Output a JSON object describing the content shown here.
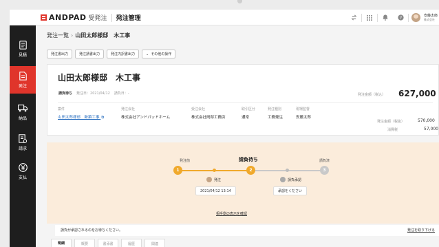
{
  "brand": {
    "logo": "ANDPAD",
    "product": "受発注",
    "app_title": "発注管理",
    "accent": "#e0352b"
  },
  "user": {
    "name": "安藤太郎",
    "company": "株式会社"
  },
  "sidebar": {
    "items": [
      {
        "label": "見積",
        "icon": "estimate-icon",
        "active": false
      },
      {
        "label": "発注",
        "icon": "order-icon",
        "active": true
      },
      {
        "label": "納品",
        "icon": "delivery-truck-icon",
        "active": false
      },
      {
        "label": "請求",
        "icon": "invoice-icon",
        "active": false
      },
      {
        "label": "支払",
        "icon": "yen-icon",
        "active": false
      }
    ]
  },
  "breadcrumb": {
    "parent": "発注一覧",
    "separator": "›",
    "current": "山田太郎様邸　木工事"
  },
  "actions": [
    {
      "label": "発注書出力"
    },
    {
      "label": "発注請書出力"
    },
    {
      "label": "発注内訳書出力"
    },
    {
      "label": "その他の操作"
    }
  ],
  "order": {
    "title": "山田太郎様邸　木工事",
    "status": "請負待ち",
    "order_date_label": "発注日：2021/04/12",
    "receipt_date_label": "請負日：-",
    "amount_label": "発注金額（税込）",
    "amount": "627,000 円"
  },
  "info": {
    "case": {
      "label": "案件",
      "value": "山田太郎様邸　新築工事"
    },
    "ordering_company": {
      "label": "発注会社",
      "value": "株式会社アンドパッドホーム"
    },
    "receiving_company": {
      "label": "受注会社",
      "value": "株式会社岡部工務店"
    },
    "trade_type": {
      "label": "取引区分",
      "value": "通常"
    },
    "order_type": {
      "label": "発注種別",
      "value": "工務発注"
    },
    "supervisor": {
      "label": "現場監督",
      "value": "安藤太郎"
    }
  },
  "summary": {
    "amount_label": "発注金額（税抜）",
    "amount_value": "570,000",
    "tax_label": "消費税",
    "tax_value": "57,000"
  },
  "progress": {
    "steps": [
      {
        "number": "1",
        "label": "発注前"
      },
      {
        "number": "2",
        "label": "請負待ち"
      },
      {
        "number": "3",
        "label": "請負済"
      }
    ],
    "current_label": "請負待ち",
    "events": [
      {
        "label": "発注",
        "detail": "2021/04/12 13:14"
      },
      {
        "label": "請負承認",
        "detail": "承認をください"
      }
    ],
    "link": "相手側の表示を確認",
    "note": "請負が承認されるのをお待ちください。",
    "note_link": "発注を取り下げる"
  },
  "tabs": [
    {
      "label": "明細",
      "active": true
    },
    {
      "label": "概要",
      "active": false
    },
    {
      "label": "書添書",
      "active": false
    },
    {
      "label": "履歴",
      "active": false
    },
    {
      "label": "関連",
      "active": false
    }
  ]
}
